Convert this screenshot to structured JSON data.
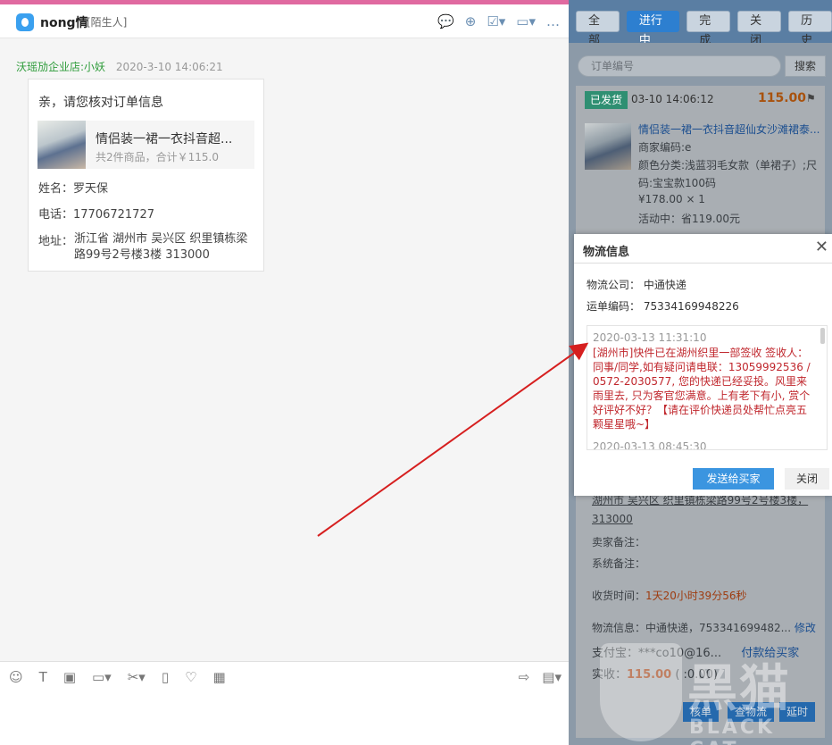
{
  "chat": {
    "name": "nong情",
    "tag": "[陌生人]",
    "sender": "沃瑶劢企业店:小妖",
    "time": "2020-3-10 14:06:21",
    "card": {
      "title": "亲，请您核对订单信息",
      "product_name": "情侣装一裙一衣抖音超...",
      "product_sub": "共2件商品，合计￥115.0",
      "name_label": "姓名：",
      "name_value": "罗天保",
      "phone_label": "电话：",
      "phone_value": "17706721727",
      "addr_label": "地址：",
      "addr_value": "浙江省 湖州市 吴兴区 织里镇栋梁路99号2号楼3楼 313000"
    }
  },
  "side": {
    "tabs": [
      "全部",
      "进行中",
      "完成",
      "关闭",
      "历史"
    ],
    "active_tab": "进行中",
    "search_placeholder": "订单编号",
    "search_btn": "搜索",
    "order": {
      "status": "已发货",
      "time": "03-10 14:06:12",
      "price": "115.00",
      "title": "情侣装一裙一衣抖音超仙女沙滩裙泰...",
      "merchant_code": "商家编码:e",
      "variant1": "颜色分类:浅蓝羽毛女款（单裙子）;尺",
      "variant2": "码:宝宝款100码",
      "unit": "¥178.00 × 1",
      "activity": "活动中：省119.00元",
      "addr1": "湖州市 吴兴区 织里镇栋梁路99号2号楼3楼，",
      "addr2": "313000",
      "seller_note": "卖家备注：",
      "system_note": "系统备注：",
      "receive_label": "收货时间：",
      "receive_value": "1天20小时39分56秒",
      "logistics": "物流信息：中通快递，753341699482...",
      "modify": "修改",
      "alipay": "支付宝：***co10@16...",
      "pay_link": "付款给买家",
      "paid_label": "实收：",
      "paid_value": "115.00",
      "paid_extra": "(      :0.00)"
    },
    "buttons": [
      "核单",
      "查物流",
      "延时"
    ]
  },
  "modal": {
    "title": "物流信息",
    "company_label": "物流公司：",
    "company": "中通快递",
    "waybill_label": "运单编码：",
    "waybill": "75334169948226",
    "entry1_time": "2020-03-13 11:31:10",
    "entry1_text": "[湖州市]快件已在湖州织里一部签收 签收人：同事/同学,如有疑问请电联：13059992536 / 0572-2030577, 您的快递已经妥投。风里来雨里去, 只为客官您满意。上有老下有小, 赏个好评好不好？【请在评价快递员处帮忙点亮五颗星星哦~】",
    "entry2_time": "2020-03-13 08:45:30",
    "send_btn": "发送给买家",
    "close_btn": "关闭"
  },
  "watermark": {
    "cn": "黑猫",
    "en": "BLACK CAT"
  },
  "colors": {
    "accent": "#3b95e0",
    "sender_green": "#2e9c3a",
    "track_red": "#c0272d",
    "arrow_red": "#d61f1f"
  }
}
